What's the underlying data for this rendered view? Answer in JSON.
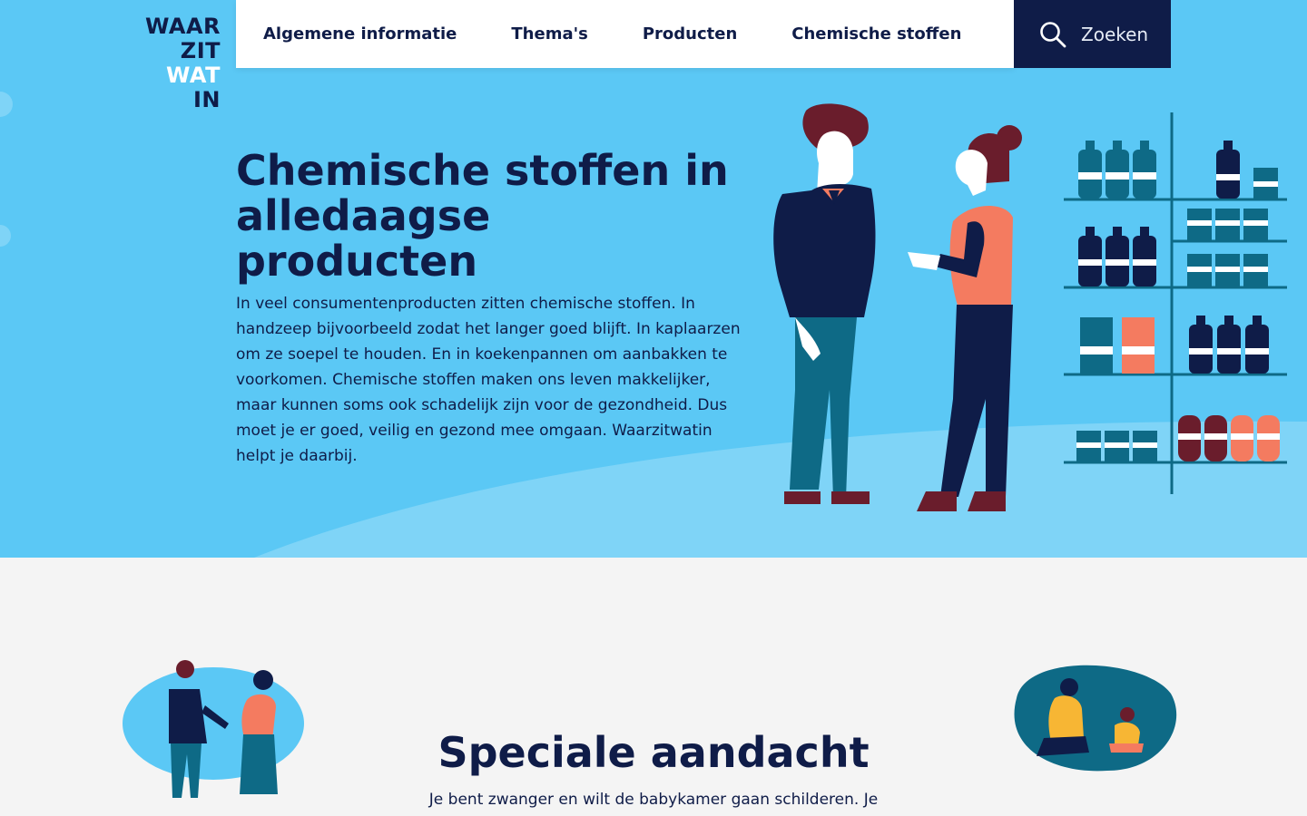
{
  "logo": {
    "line1": "WAAR",
    "line2": "ZIT",
    "line3": "WAT",
    "line4": "IN"
  },
  "nav": {
    "items": [
      {
        "label": "Algemene informatie"
      },
      {
        "label": "Thema's"
      },
      {
        "label": "Producten"
      },
      {
        "label": "Chemische stoffen"
      }
    ]
  },
  "search": {
    "label": "Zoeken",
    "icon": "search-icon"
  },
  "hero": {
    "title": "Chemische stoffen in alledaagse producten",
    "text": "In veel consumentenproducten zitten chemische stoffen. In handzeep bijvoorbeeld zodat het langer goed blijft. In kaplaarzen om ze soepel te houden. En in koekenpannen om aanbakken te voorkomen. Chemische stoffen maken ons leven makkelijker, maar kunnen soms ook schadelijk zijn voor de gezondheid. Dus moet je er goed, veilig en gezond mee omgaan. Waarzitwatin helpt je daarbij."
  },
  "special": {
    "title": "Speciale aandacht",
    "text": "Je bent zwanger en wilt de babykamer gaan schilderen. Je"
  },
  "colors": {
    "navy": "#0f1c48",
    "sky": "#5bc8f5",
    "coral": "#f47b60",
    "teal": "#0e6a86",
    "maroon": "#6a1d2c"
  }
}
